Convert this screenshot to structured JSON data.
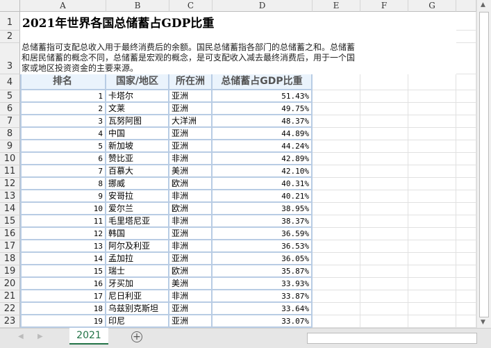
{
  "columns": [
    "A",
    "B",
    "C",
    "D",
    "E",
    "F",
    "G"
  ],
  "title": "2021年世界各国总储蓄占GDP比重",
  "description": "总储蓄指可支配总收入用于最终消费后的余额。国民总储蓄指各部门的总储蓄之和。总储蓄和居民储蓄的概念不同，总储蓄是宏观的概念，是可支配收入减去最终消费后，用于一个国家或地区投资资金的主要来源。",
  "table": {
    "headers": [
      "排名",
      "国家/地区",
      "所在洲",
      "总储蓄占GDP比重"
    ],
    "rows": [
      [
        "1",
        "卡塔尔",
        "亚洲",
        "51.43%"
      ],
      [
        "2",
        "文莱",
        "亚洲",
        "49.75%"
      ],
      [
        "3",
        "瓦努阿图",
        "大洋洲",
        "48.37%"
      ],
      [
        "4",
        "中国",
        "亚洲",
        "44.89%"
      ],
      [
        "5",
        "新加坡",
        "亚洲",
        "44.24%"
      ],
      [
        "6",
        "赞比亚",
        "非洲",
        "42.89%"
      ],
      [
        "7",
        "百慕大",
        "美洲",
        "42.10%"
      ],
      [
        "8",
        "挪威",
        "欧洲",
        "40.31%"
      ],
      [
        "9",
        "安哥拉",
        "非洲",
        "40.21%"
      ],
      [
        "10",
        "爱尔兰",
        "欧洲",
        "38.95%"
      ],
      [
        "11",
        "毛里塔尼亚",
        "非洲",
        "38.37%"
      ],
      [
        "12",
        "韩国",
        "亚洲",
        "36.59%"
      ],
      [
        "13",
        "阿尔及利亚",
        "非洲",
        "36.53%"
      ],
      [
        "14",
        "孟加拉",
        "亚洲",
        "36.05%"
      ],
      [
        "15",
        "瑞士",
        "欧洲",
        "35.87%"
      ],
      [
        "16",
        "牙买加",
        "美洲",
        "33.93%"
      ],
      [
        "17",
        "尼日利亚",
        "非洲",
        "33.87%"
      ],
      [
        "18",
        "乌兹别克斯坦",
        "亚洲",
        "33.64%"
      ],
      [
        "19",
        "印尼",
        "亚洲",
        "33.07%"
      ]
    ]
  },
  "sheet_tab": "2021",
  "add_sheet_icon": "plus-circle-icon",
  "accent": "#217346"
}
